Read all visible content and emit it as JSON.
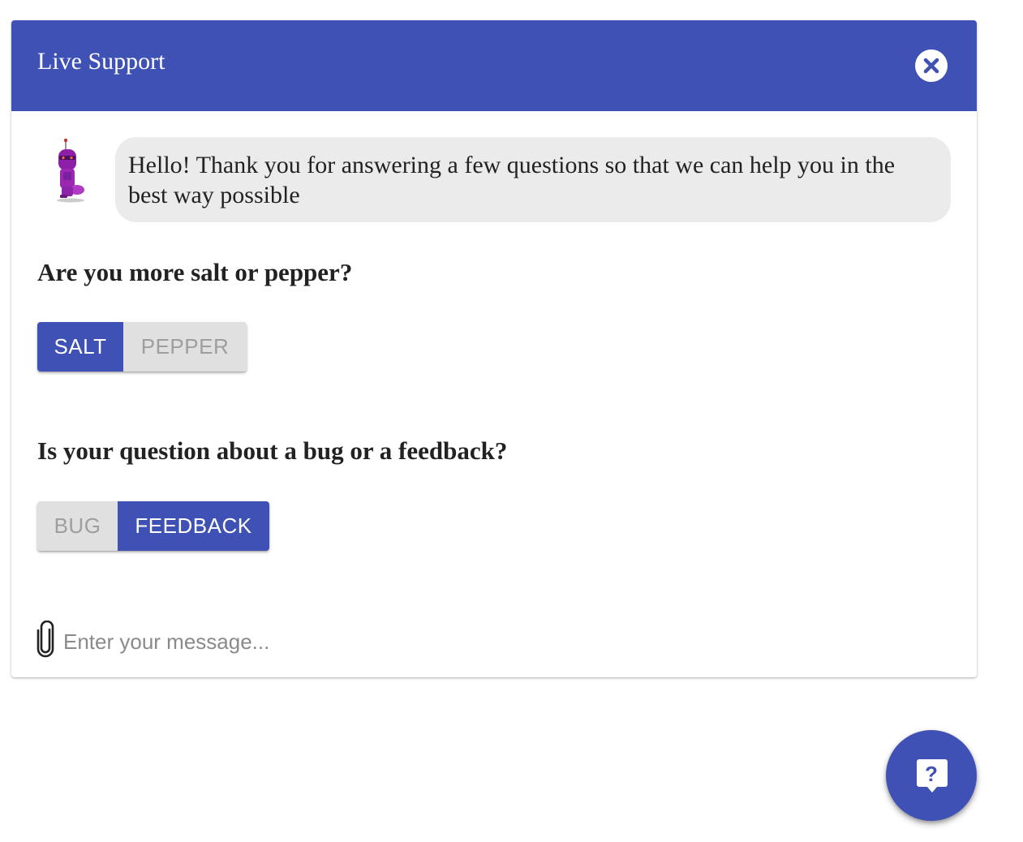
{
  "header": {
    "title": "Live Support",
    "close_icon": "close-circle-icon"
  },
  "conversation": {
    "avatar_icon": "robot-avatar-icon",
    "greeting": "Hello! Thank you for answering a few questions so that we can help you in the best way possible"
  },
  "questions": [
    {
      "text": "Are you more salt or pepper?",
      "options": [
        {
          "label": "SALT",
          "selected": true
        },
        {
          "label": "PEPPER",
          "selected": false
        }
      ]
    },
    {
      "text": "Is your question about a bug or a feedback?",
      "options": [
        {
          "label": "BUG",
          "selected": false
        },
        {
          "label": "FEEDBACK",
          "selected": true
        }
      ]
    }
  ],
  "composer": {
    "attach_icon": "paperclip-icon",
    "placeholder": "Enter your message..."
  },
  "fab": {
    "icon": "help-chat-icon"
  },
  "colors": {
    "primary": "#3f51b5",
    "bubble": "#ebebeb",
    "toggle_off": "#e0e0e0",
    "toggle_off_text": "#9e9e9e"
  }
}
